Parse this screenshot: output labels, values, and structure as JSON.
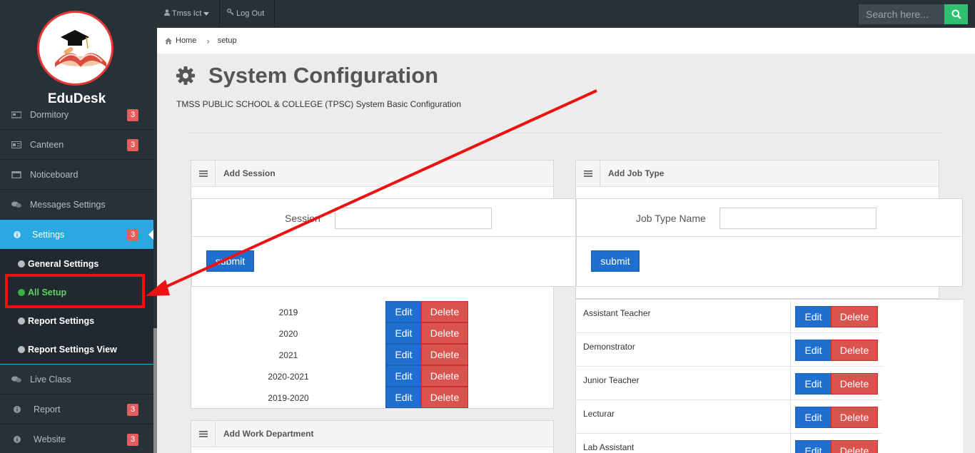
{
  "brand": {
    "name": "EduDesk"
  },
  "topbar": {
    "user_label": "Tmss Ict",
    "logout_label": "Log Out",
    "search_placeholder": "Search here..."
  },
  "breadcrumb": {
    "home": "Home",
    "current": "setup"
  },
  "page": {
    "title": "System Configuration",
    "subtitle": "TMSS PUBLIC SCHOOL & COLLEGE (TPSC) System Basic Configuration"
  },
  "sidebar": {
    "items": [
      {
        "label": "Dormitory",
        "badge": "3",
        "icon": "bed-icon"
      },
      {
        "label": "Canteen",
        "badge": "3",
        "icon": "id-card-icon"
      },
      {
        "label": "Noticeboard",
        "badge": "",
        "icon": "window-icon"
      },
      {
        "label": "Messages Settings",
        "badge": "",
        "icon": "comments-icon"
      },
      {
        "label": "Settings",
        "badge": "3",
        "icon": "info-icon"
      }
    ],
    "submenu": [
      {
        "label": "General Settings"
      },
      {
        "label": "All Setup"
      },
      {
        "label": "Report Settings"
      },
      {
        "label": "Report Settings View"
      }
    ],
    "items_after": [
      {
        "label": "Live Class",
        "badge": "",
        "icon": "comments-icon"
      },
      {
        "label": "Report",
        "badge": "3",
        "icon": "info-icon"
      },
      {
        "label": "Website",
        "badge": "3",
        "icon": "info-icon"
      }
    ]
  },
  "session_panel": {
    "title": "Add Session",
    "field_label": "Session",
    "submit_label": "submit",
    "rows": [
      "2019",
      "2020",
      "2021",
      "2020-2021",
      "2019-2020"
    ],
    "edit_label": "Edit",
    "delete_label": "Delete"
  },
  "jobtype_panel": {
    "title": "Add Job Type",
    "field_label": "Job Type Name",
    "submit_label": "submit",
    "rows": [
      "Assistant Teacher",
      "Demonstrator",
      "Junior Teacher",
      "Lecturar",
      "Lab Assistant"
    ],
    "edit_label": "Edit",
    "delete_label": "Delete"
  },
  "work_dept_panel": {
    "title": "Add Work Department"
  },
  "colors": {
    "sidebar_bg": "#263238",
    "active_blue": "#29a9e0",
    "badge_red": "#e55e5e",
    "edit_blue": "#1f6fcf",
    "delete_red": "#d9534f",
    "search_green": "#2fbf71",
    "annotation_red": "#ee1111"
  }
}
